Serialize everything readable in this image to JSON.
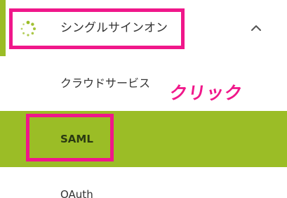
{
  "menu": {
    "header": {
      "label": "シングルサインオン",
      "icon": "loading-dots-icon",
      "chevron_icon": "chevron-up-icon",
      "expanded": true
    },
    "items": [
      {
        "label": "クラウドサービス",
        "selected": false
      },
      {
        "label": "SAML",
        "selected": true
      },
      {
        "label": "OAuth",
        "selected": false
      }
    ]
  },
  "annotation": {
    "text": "クリック"
  },
  "colors": {
    "accent_green": "#9bbd26",
    "highlight_pink": "#f0178a",
    "text": "#333333"
  }
}
